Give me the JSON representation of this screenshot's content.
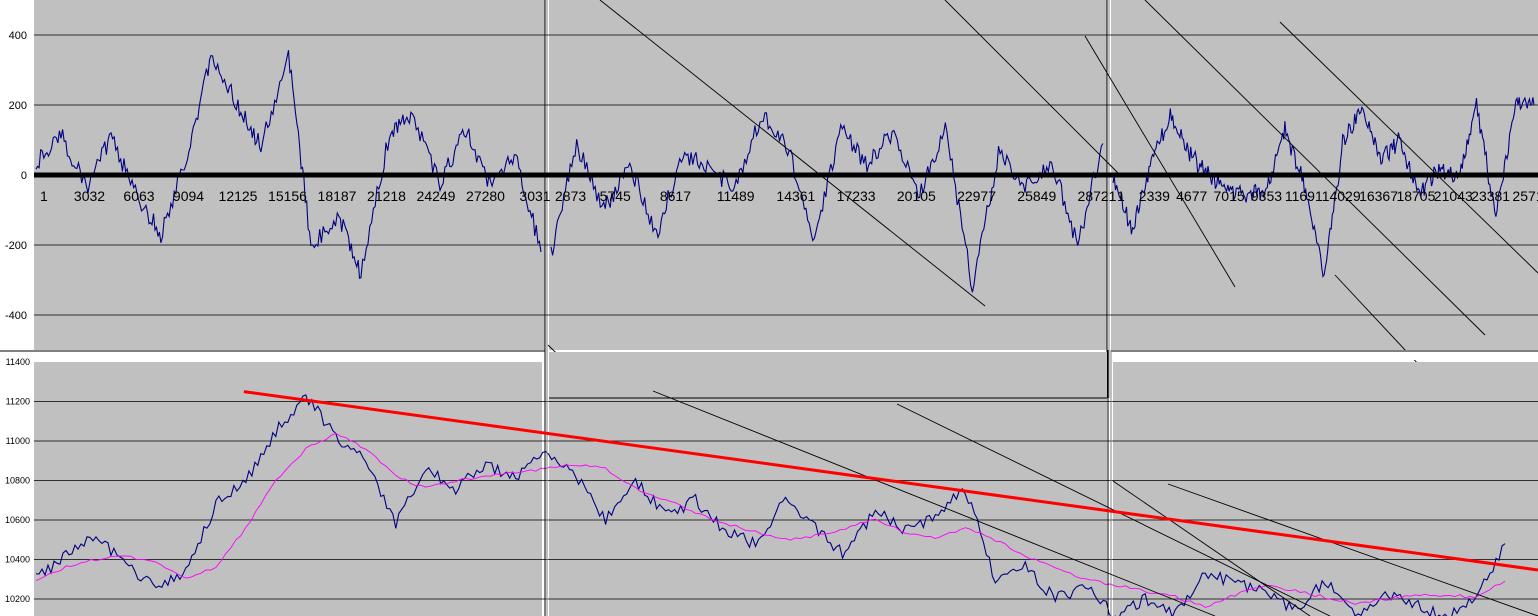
{
  "chart_data": [
    {
      "type": "line",
      "panel": "top",
      "ylim": [
        -500,
        500
      ],
      "y_tick_labels": [
        "400",
        "200",
        "0",
        "-200",
        "-400"
      ],
      "y_ticks": [
        400,
        200,
        0,
        -200,
        -400
      ],
      "zero_line": true,
      "grid": true,
      "segments": [
        {
          "x_tick_labels": [
            "1",
            "3032",
            "6063",
            "9094",
            "12125",
            "15156",
            "18187",
            "21218",
            "24249",
            "27280",
            "3031"
          ],
          "x": [
            1,
            1500,
            3032,
            4500,
            6063,
            7500,
            9094,
            10500,
            12125,
            13500,
            15156,
            16500,
            18187,
            19500,
            21218,
            22500,
            24249,
            25800,
            27280,
            28800,
            30310
          ],
          "values": [
            30,
            120,
            -40,
            110,
            -60,
            -170,
            60,
            340,
            200,
            80,
            350,
            -200,
            -120,
            -280,
            120,
            170,
            -20,
            130,
            -30,
            60,
            -220
          ]
        },
        {
          "x_tick_labels": [
            "2873",
            "5745",
            "8617",
            "11489",
            "14361",
            "17233",
            "20105",
            "22977",
            "25849",
            "28721"
          ],
          "x": [
            1,
            1400,
            2873,
            4300,
            5745,
            7200,
            8617,
            10000,
            11489,
            12900,
            14361,
            15800,
            17233,
            18600,
            20105,
            21500,
            22977,
            24400,
            25849,
            27300,
            28721,
            30100
          ],
          "values": [
            -230,
            90,
            -100,
            30,
            -170,
            60,
            20,
            -40,
            170,
            80,
            -180,
            130,
            30,
            120,
            -60,
            140,
            -320,
            60,
            -30,
            40,
            -200,
            90
          ]
        },
        {
          "x_tick_labels": [
            "1",
            "2339",
            "4677",
            "7015",
            "9353",
            "11691",
            "14029",
            "16367",
            "18705",
            "21043",
            "23381",
            "2571"
          ],
          "x": [
            1,
            1200,
            2339,
            3500,
            4677,
            5800,
            7015,
            8200,
            9353,
            10500,
            11691,
            12900,
            14029,
            15200,
            16367,
            17500,
            18705,
            19900,
            21043,
            22200,
            23381,
            24600,
            25710
          ],
          "values": [
            -10,
            -160,
            40,
            170,
            60,
            0,
            -40,
            -60,
            -40,
            130,
            -30,
            -290,
            90,
            200,
            40,
            100,
            -60,
            20,
            -10,
            200,
            -120,
            210,
            200
          ]
        }
      ]
    },
    {
      "type": "line",
      "panel": "bottom",
      "ylim": [
        10150,
        11400
      ],
      "y_tick_labels": [
        "11400",
        "11200",
        "11000",
        "10800",
        "10600",
        "10400",
        "10200"
      ],
      "y_ticks": [
        11400,
        11200,
        11000,
        10800,
        10600,
        10400,
        10200
      ],
      "grid": true,
      "series": [
        {
          "role": "price",
          "color": "#000080",
          "values": [
            10300,
            10420,
            10520,
            10380,
            10250,
            10330,
            10680,
            10800,
            11050,
            11230,
            11020,
            10900,
            10580,
            10860,
            10760,
            10880,
            10820,
            10960,
            10830,
            10600,
            10800,
            10620,
            10700,
            10540,
            10480,
            10700,
            10560,
            10420,
            10650,
            10550,
            10620,
            10760,
            10300,
            10360,
            10200,
            10260,
            10120,
            10200,
            10130,
            10340,
            10280,
            10230,
            10140,
            10290,
            10110,
            10230,
            10180,
            10100,
            10200,
            10480
          ]
        },
        {
          "role": "moving-average",
          "color": "#ff00ff",
          "values": [
            10300,
            10360,
            10400,
            10420,
            10380,
            10300,
            10360,
            10560,
            10800,
            10960,
            11040,
            10960,
            10820,
            10760,
            10800,
            10820,
            10840,
            10860,
            10880,
            10860,
            10760,
            10700,
            10640,
            10580,
            10540,
            10500,
            10520,
            10560,
            10600,
            10540,
            10510,
            10560,
            10500,
            10420,
            10360,
            10300,
            10270,
            10240,
            10210,
            10160,
            10220,
            10270,
            10240,
            10210,
            10180,
            10200,
            10220,
            10220,
            10210,
            10290
          ]
        }
      ],
      "trendlines": [
        {
          "color": "#ff0000",
          "from": {
            "x": 7,
            "y": 11250
          },
          "to": {
            "x": 49,
            "y": 10370
          }
        }
      ]
    }
  ]
}
